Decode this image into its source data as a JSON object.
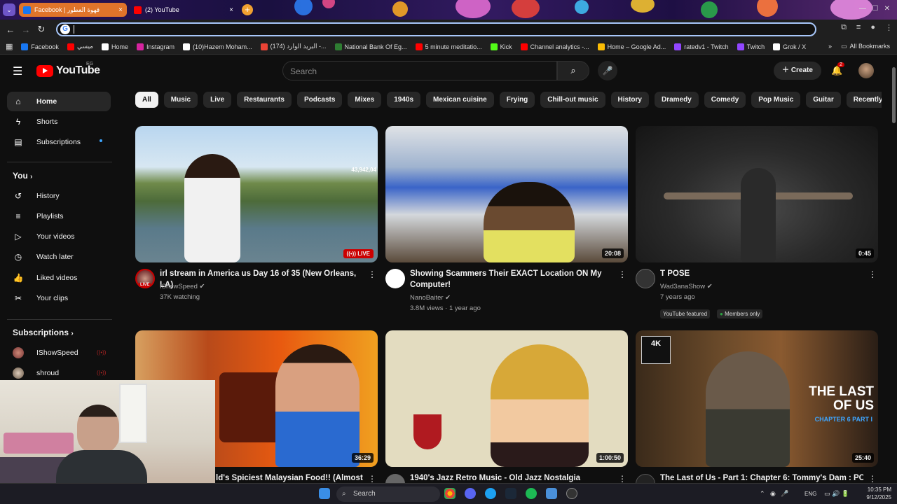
{
  "browser": {
    "tabs": [
      {
        "title": "Facebook | قهوة العطور"
      },
      {
        "title": "(2) YouTube"
      }
    ],
    "bookmarks": [
      {
        "label": "Facebook",
        "color": "#1877f2"
      },
      {
        "label": "ميسي",
        "color": "#ff0000"
      },
      {
        "label": "Home",
        "color": "#ffffff"
      },
      {
        "label": "Instagram",
        "color": "#d6249f"
      },
      {
        "label": "(10)Hazem Moham...",
        "color": "#ffffff"
      },
      {
        "label": "(174) البريد الوارد -...",
        "color": "#ea4335"
      },
      {
        "label": "National Bank Of Eg...",
        "color": "#2e7d32"
      },
      {
        "label": "5 minute meditatio...",
        "color": "#ff0000"
      },
      {
        "label": "Kick",
        "color": "#53fc18"
      },
      {
        "label": "Channel analytics -...",
        "color": "#ff0000"
      },
      {
        "label": "Home – Google Ad...",
        "color": "#fbbc04"
      },
      {
        "label": "ratedv1 - Twitch",
        "color": "#9146ff"
      },
      {
        "label": "Twitch",
        "color": "#9146ff"
      },
      {
        "label": "Grok / X",
        "color": "#ffffff"
      }
    ],
    "all_bookmarks": "All Bookmarks"
  },
  "header": {
    "logo": "YouTube",
    "country": "EG",
    "search_placeholder": "Search",
    "create": "Create",
    "notifications": "2"
  },
  "sidebar": {
    "main": [
      "Home",
      "Shorts",
      "Subscriptions"
    ],
    "you_heading": "You",
    "you_items": [
      "History",
      "Playlists",
      "Your videos",
      "Watch later",
      "Liked videos",
      "Your clips"
    ],
    "subs_heading": "Subscriptions",
    "subs": [
      "IShowSpeed",
      "shroud"
    ]
  },
  "chips": [
    "All",
    "Music",
    "Live",
    "Restaurants",
    "Podcasts",
    "Mixes",
    "1940s",
    "Mexican cuisine",
    "Frying",
    "Chill-out music",
    "History",
    "Dramedy",
    "Comedy",
    "Pop Music",
    "Guitar",
    "Recently uploa"
  ],
  "videos": [
    {
      "title": "irl stream in America us Day 16 of 35 (New Orleans, LA)",
      "channel": "IShowSpeed",
      "meta": "37K watching",
      "badge": "LIVE",
      "overlay": "43,942,04"
    },
    {
      "title": "Showing Scammers Their EXACT Location ON My Computer!",
      "channel": "NanoBaiter",
      "meta": "3.8M views · 1 year ago",
      "duration": "20:08"
    },
    {
      "title": "T POSE",
      "channel": "Wad3anaShow",
      "meta": "7 years ago",
      "duration": "0:45",
      "tags": [
        "YouTube featured",
        "Members only"
      ]
    },
    {
      "title": "ld's Spiciest Malaysian Food!! (Almost",
      "duration": "36:29"
    },
    {
      "title": "1940's Jazz Retro Music - Old Jazz Nostalgia",
      "duration": "1:00:50"
    },
    {
      "title": "The Last of Us - Part 1: Chapter 6: Tommy's Dam : PC",
      "duration": "25:40",
      "overlay1": "THE LAST OF US",
      "overlay2": "CHAPTER 6 PART I",
      "badge4k": "4K"
    }
  ],
  "taskbar": {
    "search": "Search",
    "lang": "ENG",
    "time": "10:35 PM",
    "date": "9/12/2025"
  }
}
